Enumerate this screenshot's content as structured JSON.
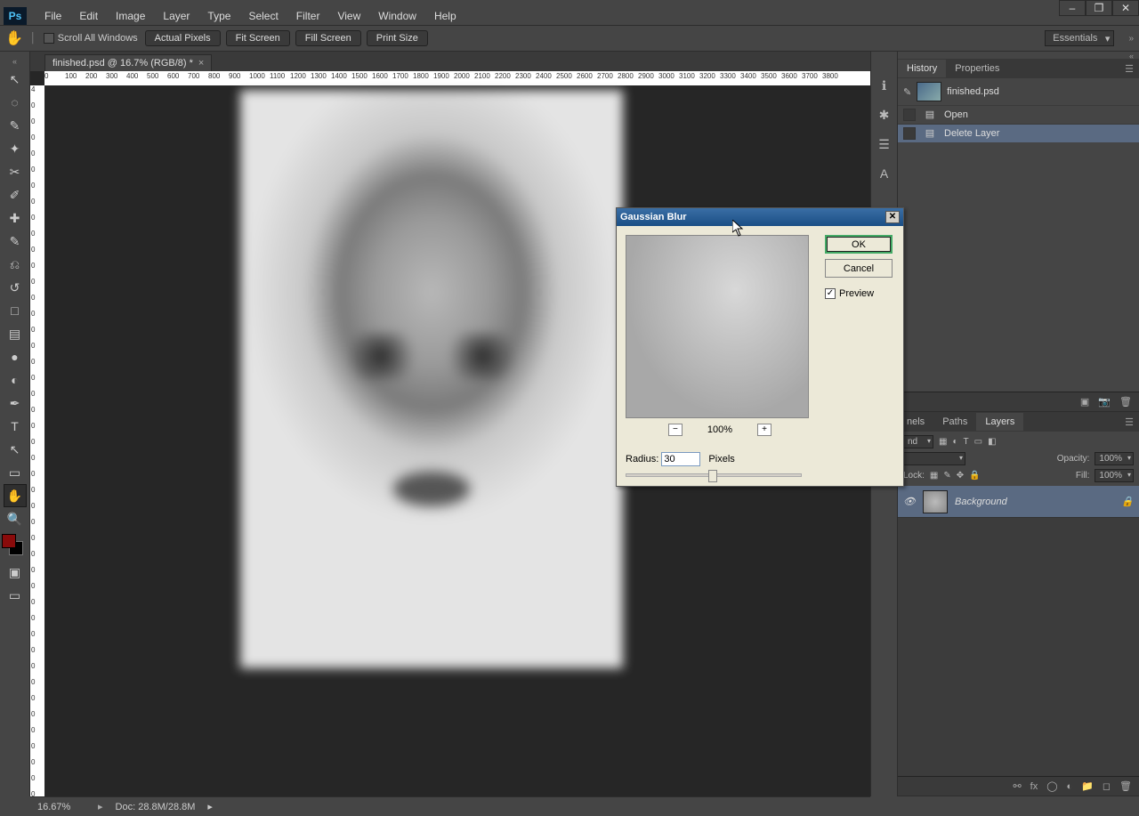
{
  "window_controls": {
    "min": "–",
    "max": "❐",
    "close": "✕"
  },
  "menu": [
    "File",
    "Edit",
    "Image",
    "Layer",
    "Type",
    "Select",
    "Filter",
    "View",
    "Window",
    "Help"
  ],
  "ps_logo": "Ps",
  "options_bar": {
    "scroll_all": "Scroll All Windows",
    "buttons": [
      "Actual Pixels",
      "Fit Screen",
      "Fill Screen",
      "Print Size"
    ],
    "workspace": "Essentials"
  },
  "doc_tab": {
    "title": "finished.psd @ 16.7% (RGB/8) *"
  },
  "ruler_h": [
    0,
    100,
    200,
    300,
    400,
    500,
    600,
    700,
    800,
    900,
    1000,
    1100,
    1200,
    1300,
    1400,
    1500,
    1600,
    1700,
    1800,
    1900,
    2000,
    2100,
    2200,
    2300,
    2400,
    2500,
    2600,
    2700,
    2800,
    2900,
    3000,
    3100,
    3200,
    3300,
    3400,
    3500,
    3600,
    3700,
    3800
  ],
  "ruler_v": [
    400,
    0,
    0,
    0,
    0,
    0,
    0,
    0,
    0,
    0,
    0,
    0,
    0,
    0,
    0,
    0,
    0,
    0,
    0,
    0,
    0,
    0,
    0,
    0,
    0,
    0,
    0,
    0,
    0,
    0,
    0,
    0,
    0,
    0,
    0,
    0,
    0,
    0,
    0,
    0,
    0,
    0,
    0,
    0,
    0,
    0
  ],
  "tools": [
    "move",
    "marquee",
    "lasso",
    "wand",
    "crop",
    "eyedrop",
    "heal",
    "brush",
    "stamp",
    "history-brush",
    "eraser",
    "gradient",
    "blur",
    "dodge",
    "pen",
    "type",
    "path-sel",
    "shape",
    "hand",
    "zoom"
  ],
  "tool_glyphs": {
    "move": "↖",
    "marquee": "◌",
    "lasso": "✎",
    "wand": "✦",
    "crop": "✂",
    "eyedrop": "✐",
    "heal": "✚",
    "brush": "✎",
    "stamp": "⎌",
    "history-brush": "↺",
    "eraser": "□",
    "gradient": "▤",
    "blur": "●",
    "dodge": "◐",
    "pen": "✒",
    "type": "T",
    "path-sel": "↖",
    "shape": "▭",
    "hand": "✋",
    "zoom": "🔍"
  },
  "selected_tool": "hand",
  "dock_strip": [
    "ℹ",
    "✱",
    "☰",
    "A"
  ],
  "panels": {
    "history": {
      "tabs": [
        "History",
        "Properties"
      ],
      "active": "History",
      "file": "finished.psd",
      "rows": [
        {
          "label": "Open",
          "selected": false
        },
        {
          "label": "Delete Layer",
          "selected": true
        }
      ]
    },
    "layers": {
      "tabs_left": [
        "nels",
        "Paths",
        "Layers"
      ],
      "active": "Layers",
      "blend": "nd",
      "opacity_label": "Opacity:",
      "opacity": "100%",
      "lock_label": "Lock:",
      "fill_label": "Fill:",
      "fill": "100%",
      "items": [
        {
          "name": "Background",
          "locked": true
        }
      ]
    }
  },
  "status": {
    "zoom": "16.67%",
    "doc": "Doc: 28.8M/28.8M"
  },
  "dialog": {
    "title": "Gaussian Blur",
    "ok": "OK",
    "cancel": "Cancel",
    "preview": "Preview",
    "zoom": "100%",
    "radius_label": "Radius:",
    "radius": "30",
    "unit": "Pixels",
    "minus": "−",
    "plus": "+"
  }
}
